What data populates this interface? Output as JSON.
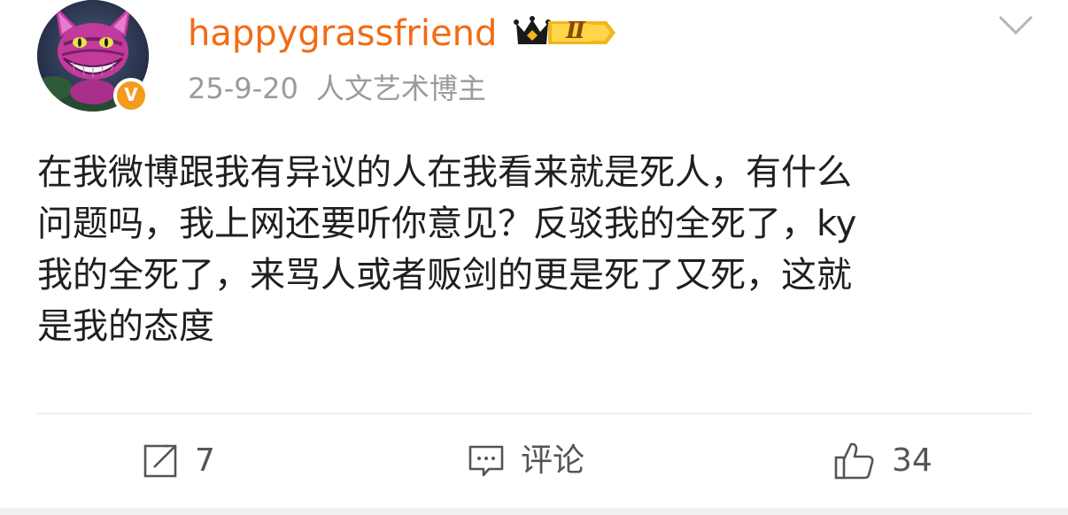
{
  "post": {
    "username": "happygrassfriend",
    "vip_level": "Ⅱ",
    "verified_badge": "V",
    "date": "25-9-20",
    "user_tag": "人文艺术博主",
    "content": "在我微博跟我有异议的人在我看来就是死人，有什么\n问题吗，我上网还要听你意见？反驳我的全死了，ky\n我的全死了，来骂人或者贩剑的更是死了又死，这就\n是我的态度",
    "colors": {
      "username": "#f26b15",
      "meta": "#9b9b9b",
      "badge": "#f39b1a"
    }
  },
  "actions": {
    "repost": {
      "icon": "repost-icon",
      "label": "7"
    },
    "comment": {
      "icon": "comment-icon",
      "label": "评论"
    },
    "like": {
      "icon": "thumbs-up-icon",
      "label": "34"
    }
  },
  "menu_icon": "chevron-down-icon"
}
